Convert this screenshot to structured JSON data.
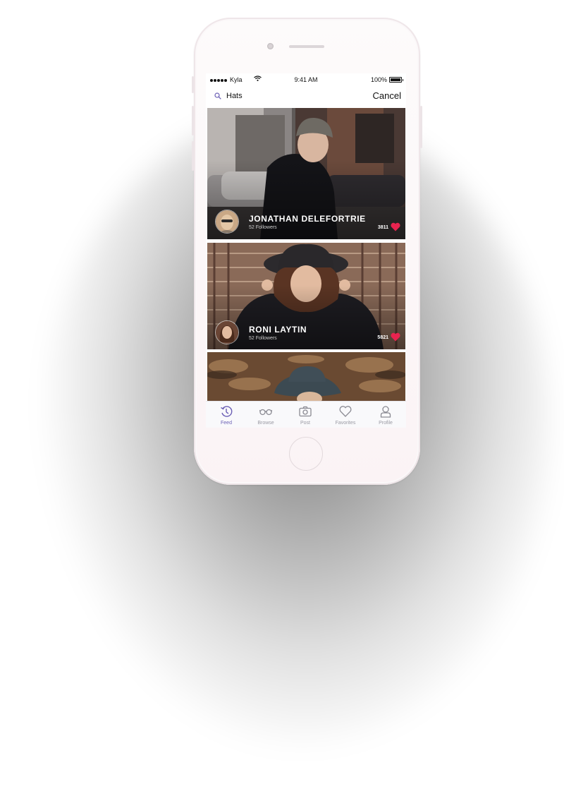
{
  "status_bar": {
    "carrier": "Kyla",
    "time": "9:41 AM",
    "battery": "100%"
  },
  "search": {
    "query": "Hats",
    "cancel_label": "Cancel"
  },
  "feed": [
    {
      "name": "JONATHAN DELEFORTRIE",
      "followers": "52 Followers",
      "likes": "3811"
    },
    {
      "name": "RONI LAYTIN",
      "followers": "52 Followers",
      "likes": "5821"
    }
  ],
  "tabs": [
    {
      "label": "Feed",
      "icon": "feed-icon",
      "active": true
    },
    {
      "label": "Browse",
      "icon": "glasses-icon"
    },
    {
      "label": "Post",
      "icon": "camera-icon"
    },
    {
      "label": "Favorites",
      "icon": "heart-icon"
    },
    {
      "label": "Profile",
      "icon": "person-icon"
    }
  ],
  "colors": {
    "accent": "#6b5fb5",
    "like": "#e8234f"
  }
}
